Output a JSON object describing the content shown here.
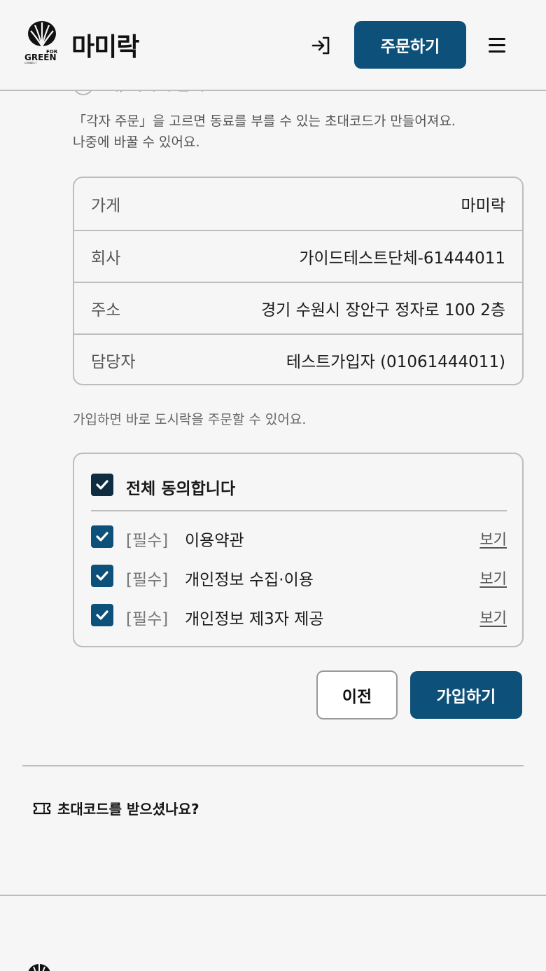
{
  "header": {
    "logo_text": "FOR GREEN",
    "brand_name": "마미락",
    "order_button_label": "주문하기"
  },
  "hidden_option": {
    "label": "네, 각자 주문해요"
  },
  "helper_text": {
    "line1": "「각자 주문」을 고르면 동료를 부를 수 있는 초대코드가 만들어져요.",
    "line2": "나중에 바꿀 수 있어요."
  },
  "info": {
    "rows": [
      {
        "label": "가게",
        "value": "마미락"
      },
      {
        "label": "회사",
        "value": "가이드테스트단체-61444011"
      },
      {
        "label": "주소",
        "value": "경기 수원시 장안구 정자로 100 2층"
      },
      {
        "label": "담당자",
        "value": "테스트가입자 (01061444011)"
      }
    ]
  },
  "signup_note": "가입하면 바로 도시락을 주문할 수 있어요.",
  "agreements": {
    "all_label": "전체 동의합니다",
    "all_checked": true,
    "items": [
      {
        "tag": "[필수]",
        "title": "이용약관",
        "view": "보기",
        "checked": true
      },
      {
        "tag": "[필수]",
        "title": "개인정보 수집·이용",
        "view": "보기",
        "checked": true
      },
      {
        "tag": "[필수]",
        "title": "개인정보 제3자 제공",
        "view": "보기",
        "checked": true
      }
    ]
  },
  "actions": {
    "prev_label": "이전",
    "signup_label": "가입하기"
  },
  "invite": {
    "question": "초대코드를 받으셨나요?"
  },
  "colors": {
    "primary": "#0d5079",
    "background": "#f6f6f6",
    "border": "#bdbdbd"
  }
}
